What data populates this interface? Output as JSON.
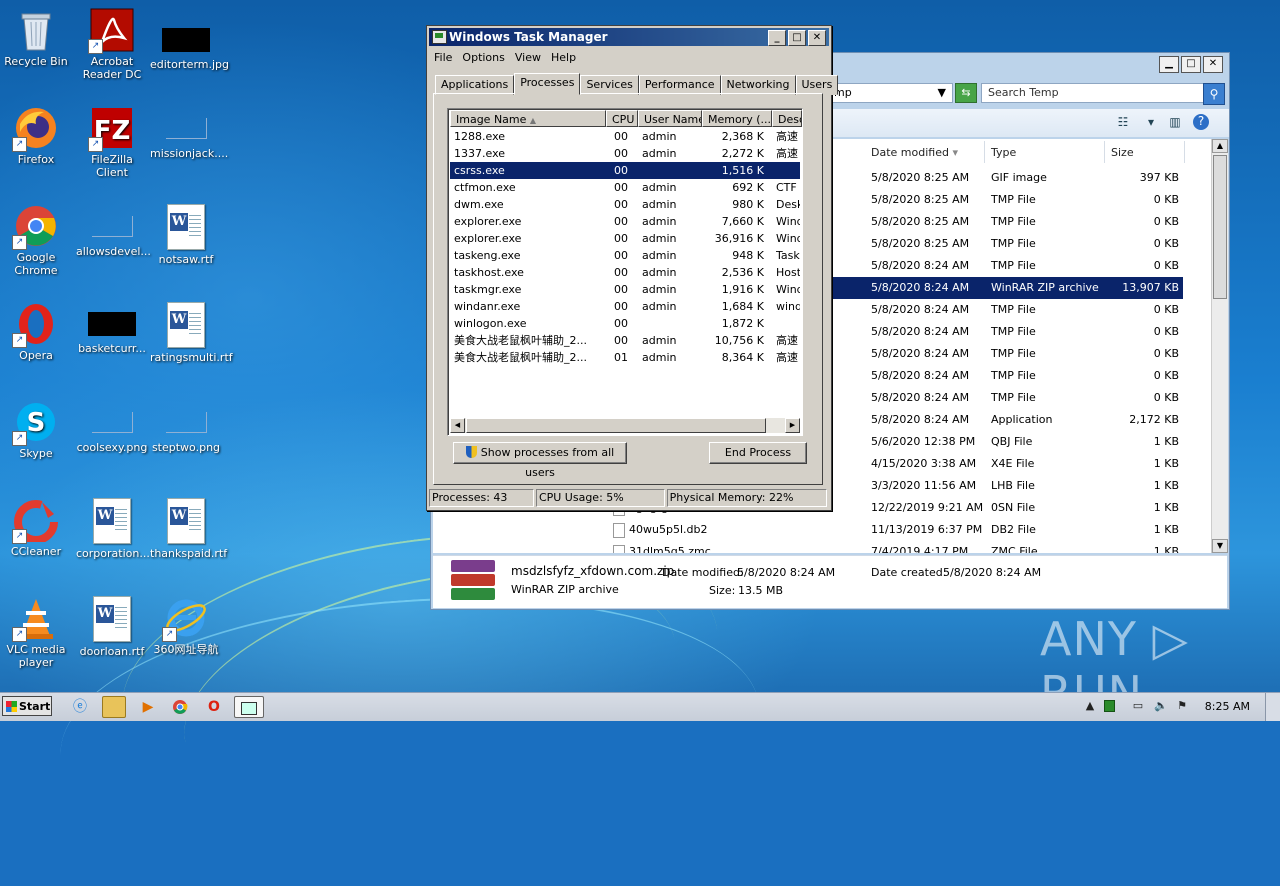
{
  "desktop": {
    "icons": [
      {
        "label": "Recycle Bin"
      },
      {
        "label": "Acrobat Reader DC"
      },
      {
        "label": "editorterm.jpg"
      },
      {
        "label": "Firefox"
      },
      {
        "label": "FileZilla Client"
      },
      {
        "label": "missionjack...."
      },
      {
        "label": "Google Chrome"
      },
      {
        "label": "allowsdevel..."
      },
      {
        "label": "notsaw.rtf"
      },
      {
        "label": "Opera"
      },
      {
        "label": "basketcurr..."
      },
      {
        "label": "ratingsmulti.rtf"
      },
      {
        "label": "Skype"
      },
      {
        "label": "coolsexy.png"
      },
      {
        "label": "steptwo.png"
      },
      {
        "label": "CCleaner"
      },
      {
        "label": "corporation..."
      },
      {
        "label": "thankspaid.rtf"
      },
      {
        "label": "VLC media player"
      },
      {
        "label": "doorloan.rtf"
      },
      {
        "label": "360网址导航"
      }
    ]
  },
  "explorer": {
    "breadcrumb": "mp",
    "search_placeholder": "Search Temp",
    "columns": {
      "date": "Date modified",
      "type": "Type",
      "size": "Size"
    },
    "files": [
      {
        "name": "",
        "date": "5/8/2020 8:25 AM",
        "type": "GIF image",
        "size": "397 KB"
      },
      {
        "name": "",
        "date": "5/8/2020 8:25 AM",
        "type": "TMP File",
        "size": "0 KB"
      },
      {
        "name": "",
        "date": "5/8/2020 8:25 AM",
        "type": "TMP File",
        "size": "0 KB"
      },
      {
        "name": "",
        "date": "5/8/2020 8:25 AM",
        "type": "TMP File",
        "size": "0 KB"
      },
      {
        "name": "",
        "date": "5/8/2020 8:24 AM",
        "type": "TMP File",
        "size": "0 KB"
      },
      {
        "name": "",
        "date": "5/8/2020 8:24 AM",
        "type": "WinRAR ZIP archive",
        "size": "13,907 KB",
        "selected": true
      },
      {
        "name": "",
        "date": "5/8/2020 8:24 AM",
        "type": "TMP File",
        "size": "0 KB"
      },
      {
        "name": "",
        "date": "5/8/2020 8:24 AM",
        "type": "TMP File",
        "size": "0 KB"
      },
      {
        "name": "",
        "date": "5/8/2020 8:24 AM",
        "type": "TMP File",
        "size": "0 KB"
      },
      {
        "name": "",
        "date": "5/8/2020 8:24 AM",
        "type": "TMP File",
        "size": "0 KB"
      },
      {
        "name": "",
        "date": "5/8/2020 8:24 AM",
        "type": "TMP File",
        "size": "0 KB"
      },
      {
        "name": "",
        "date": "5/8/2020 8:24 AM",
        "type": "Application",
        "size": "2,172 KB"
      },
      {
        "name": "",
        "date": "5/6/2020 12:38 PM",
        "type": "QBJ File",
        "size": "1 KB"
      },
      {
        "name": "",
        "date": "4/15/2020 3:38 AM",
        "type": "X4E File",
        "size": "1 KB"
      },
      {
        "name": "",
        "date": "3/3/2020 11:56 AM",
        "type": "LHB File",
        "size": "1 KB"
      },
      {
        "name": "5gngrgiz.osn",
        "date": "12/22/2019 9:21 AM",
        "type": "0SN File",
        "size": "1 KB"
      },
      {
        "name": "40wu5p5l.db2",
        "date": "11/13/2019 6:37 PM",
        "type": "DB2 File",
        "size": "1 KB"
      },
      {
        "name": "31dlm5g5.zmc",
        "date": "7/4/2019 4:17 PM",
        "type": "ZMC File",
        "size": "1 KB"
      }
    ],
    "details": {
      "filename": "msdzlsfyfz_xfdown.com.zip",
      "filetype": "WinRAR ZIP archive",
      "modified_label": "Date modified:",
      "modified": "5/8/2020 8:24 AM",
      "created_label": "Date created:",
      "created": "5/8/2020 8:24 AM",
      "size_label": "Size:",
      "size": "13.5 MB"
    }
  },
  "taskmgr": {
    "title": "Windows Task Manager",
    "menu": [
      "File",
      "Options",
      "View",
      "Help"
    ],
    "tabs": [
      "Applications",
      "Processes",
      "Services",
      "Performance",
      "Networking",
      "Users"
    ],
    "active_tab": "Processes",
    "columns": {
      "image": "Image Name",
      "cpu": "CPU",
      "user": "User Name",
      "mem": "Memory (...",
      "desc": "Desc"
    },
    "processes": [
      {
        "name": "1288.exe",
        "cpu": "00",
        "user": "admin",
        "mem": "2,368 K",
        "desc": "高速"
      },
      {
        "name": "1337.exe",
        "cpu": "00",
        "user": "admin",
        "mem": "2,272 K",
        "desc": "高速"
      },
      {
        "name": "csrss.exe",
        "cpu": "00",
        "user": "",
        "mem": "1,516 K",
        "desc": "",
        "selected": true
      },
      {
        "name": "ctfmon.exe",
        "cpu": "00",
        "user": "admin",
        "mem": "692 K",
        "desc": "CTF l"
      },
      {
        "name": "dwm.exe",
        "cpu": "00",
        "user": "admin",
        "mem": "980 K",
        "desc": "Desk"
      },
      {
        "name": "explorer.exe",
        "cpu": "00",
        "user": "admin",
        "mem": "7,660 K",
        "desc": "Wind"
      },
      {
        "name": "explorer.exe",
        "cpu": "00",
        "user": "admin",
        "mem": "36,916 K",
        "desc": "Wind"
      },
      {
        "name": "taskeng.exe",
        "cpu": "00",
        "user": "admin",
        "mem": "948 K",
        "desc": "Task"
      },
      {
        "name": "taskhost.exe",
        "cpu": "00",
        "user": "admin",
        "mem": "2,536 K",
        "desc": "Host"
      },
      {
        "name": "taskmgr.exe",
        "cpu": "00",
        "user": "admin",
        "mem": "1,916 K",
        "desc": "Wind"
      },
      {
        "name": "windanr.exe",
        "cpu": "00",
        "user": "admin",
        "mem": "1,684 K",
        "desc": "wind"
      },
      {
        "name": "winlogon.exe",
        "cpu": "00",
        "user": "",
        "mem": "1,872 K",
        "desc": ""
      },
      {
        "name": "美食大战老鼠枫叶辅助_2...",
        "cpu": "00",
        "user": "admin",
        "mem": "10,756 K",
        "desc": "高速"
      },
      {
        "name": "美食大战老鼠枫叶辅助_2...",
        "cpu": "01",
        "user": "admin",
        "mem": "8,364 K",
        "desc": "高速"
      }
    ],
    "show_all_label": "Show processes from all users",
    "end_process_label": "End Process",
    "status": {
      "processes": "Processes: 43",
      "cpu": "CPU Usage: 5%",
      "memory": "Physical Memory: 22%"
    }
  },
  "watermark": "ANY ▷ RUN",
  "taskbar": {
    "start_label": "Start",
    "clock": "8:25 AM"
  }
}
